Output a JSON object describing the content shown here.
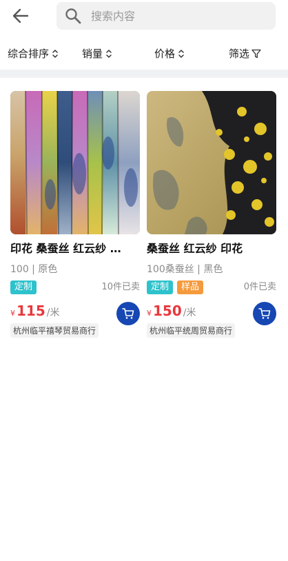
{
  "header": {
    "back_icon": "arrow-left-icon",
    "search_icon": "search-icon",
    "search_placeholder": "搜索内容",
    "search_value": ""
  },
  "sortbar": {
    "composite_label": "综合排序",
    "sales_label": "销量",
    "price_label": "价格",
    "filter_label": "筛选",
    "sort_icon": "sort-chevrons-icon",
    "filter_icon": "funnel-icon"
  },
  "products": [
    {
      "title": "印花 桑蚕丝 红云纱 …",
      "spec": "100 | 原色",
      "tags": [
        "定制"
      ],
      "sold": "10件已卖",
      "currency": "¥",
      "price": "115",
      "unit": "/米",
      "shop": "杭州临平禧琴贸易商行",
      "cart_icon": "cart-icon"
    },
    {
      "title": "桑蚕丝 红云纱 印花",
      "spec": "100桑蚕丝 | 黑色",
      "tags": [
        "定制",
        "样品"
      ],
      "sold": "0件已卖",
      "currency": "¥",
      "price": "150",
      "unit": "/米",
      "shop": "杭州临平统周贸易商行",
      "cart_icon": "cart-icon"
    }
  ],
  "colors": {
    "accent_price": "#e8383d",
    "tag_custom": "#2ec2cc",
    "tag_sample": "#f59a3c",
    "cart_button": "#1647b3"
  }
}
